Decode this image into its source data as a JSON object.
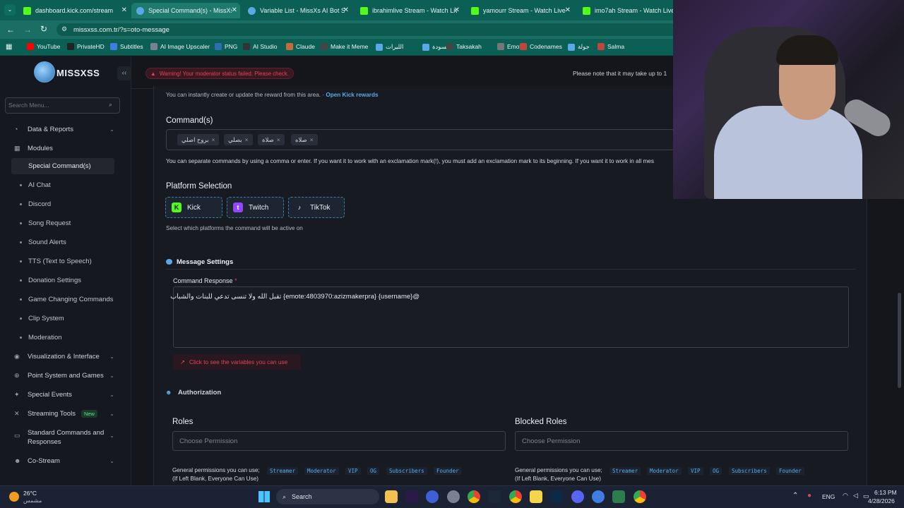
{
  "browser": {
    "tabs": [
      {
        "title": "dashboard.kick.com/stream",
        "favicon": "kick-icon",
        "color": "#53fc18"
      },
      {
        "title": "Special Command(s) - MissXss",
        "favicon": "missxss-icon",
        "color": "#5aa9e6"
      },
      {
        "title": "Variable List - MissXs AI Bot Sy",
        "favicon": "missxss-icon",
        "color": "#5aa9e6"
      },
      {
        "title": "ibrahimlive Stream - Watch Live",
        "favicon": "kick-icon",
        "color": "#53fc18"
      },
      {
        "title": "yamourr Stream - Watch Live o",
        "favicon": "kick-icon",
        "color": "#53fc18"
      },
      {
        "title": "imo7ah Stream - Watch Live on",
        "favicon": "kick-icon",
        "color": "#53fc18"
      }
    ],
    "url": "missxss.com.tr/?s=oto-message",
    "bookmarks": [
      "YouTube",
      "PrivateHD",
      "Subtitles",
      "AI Image Upscaler",
      "PNG",
      "AI Studio",
      "Claude",
      "Make it Meme",
      "الليرات",
      "مسودة",
      "Taksakah",
      "Emots",
      "Codenames",
      "جولة",
      "Salma"
    ]
  },
  "header": {
    "brand": "MISSXSS",
    "warning": "Warning! Your moderator status failed. Please check.",
    "note": "Please note that it may take up to 1"
  },
  "sidebar": {
    "search_placeholder": "Search Menu...",
    "items": [
      {
        "label": "Data & Reports",
        "icon": "chart-icon",
        "chevron": "⌄"
      },
      {
        "label": "Modules",
        "icon": "grid-icon"
      },
      {
        "label": "Visualization & Interface",
        "icon": "eye-icon",
        "chevron": "⌄"
      },
      {
        "label": "Point System and Games",
        "icon": "gamepad-icon",
        "chevron": "⌄"
      },
      {
        "label": "Special Events",
        "icon": "star-icon",
        "chevron": "⌄"
      },
      {
        "label": "Streaming Tools",
        "icon": "tools-icon",
        "badge": "New",
        "chevron": "⌄"
      },
      {
        "label": "Standard Commands and Responses",
        "icon": "terminal-icon",
        "chevron": "⌄"
      },
      {
        "label": "Co-Stream",
        "icon": "users-icon",
        "chevron": "⌄"
      }
    ],
    "modules": [
      "Special Command(s)",
      "AI Chat",
      "Discord",
      "Song Request",
      "Sound Alerts",
      "TTS (Text to Speech)",
      "Donation Settings",
      "Game Changing Commands",
      "Clip System",
      "Moderation"
    ]
  },
  "main": {
    "reward_hint": "You can instantly create or update the reward from this area. ·",
    "reward_link": "Open Kick rewards",
    "commands_title": "Command(s)",
    "commands": [
      "بروح اصلي",
      "بصلي",
      "صلاة",
      "صلاه"
    ],
    "commands_hint": "You can separate commands by using a comma or enter. If you want it to work with an exclamation mark(!), you must add an exclamation mark to its beginning. If you want it to work in all mes",
    "platform_title": "Platform Selection",
    "platforms": [
      {
        "label": "Kick",
        "color": "#53fc18"
      },
      {
        "label": "Twitch",
        "color": "#9146ff"
      },
      {
        "label": "TikTok",
        "color": "#ffffff"
      }
    ],
    "platform_hint": "Select which platforms the command will be active on",
    "message_settings": "Message Settings",
    "response_label": "Command Response",
    "required_mark": "*",
    "response_value": "@{username} {emote:4803970:azizmakerpra} تقبل الله ولا تنسى تدعي للبنات والشباب",
    "variables_button": "Click to see the variables you can use",
    "authorization": "Authorization",
    "roles_title": "Roles",
    "blocked_roles_title": "Blocked Roles",
    "choose_permission": "Choose Permission",
    "general_permissions": "General permissions you can use;",
    "blank_note": "(If Left Blank, Everyone Can Use)",
    "permission_chips": [
      "Streamer",
      "Moderator",
      "VIP",
      "OG",
      "Subscribers",
      "Founder"
    ]
  },
  "taskbar": {
    "weather_temp": "26°C",
    "weather_desc": "مشمس",
    "search": "Search",
    "lang": "ENG",
    "time": "6:13 PM",
    "date": "4/28/2026"
  },
  "colors": {
    "accent": "#5aa9e6",
    "danger": "#e0435c",
    "browser": "#0b5f55"
  }
}
